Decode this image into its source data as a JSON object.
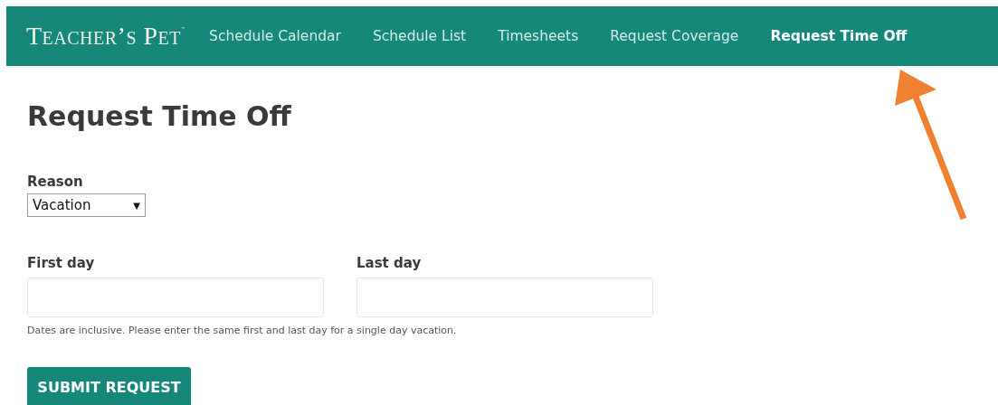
{
  "nav": {
    "logo": "Teacher’s Pet",
    "logo_mark": "™",
    "items": [
      {
        "label": "Schedule Calendar",
        "selected": false
      },
      {
        "label": "Schedule List",
        "selected": false
      },
      {
        "label": "Timesheets",
        "selected": false
      },
      {
        "label": "Request Coverage",
        "selected": false
      },
      {
        "label": "Request Time Off",
        "selected": true
      }
    ]
  },
  "page_title": "Request Time Off",
  "reason": {
    "label": "Reason",
    "value": "Vacation",
    "caret": "▼"
  },
  "first_day": {
    "label": "First day"
  },
  "last_day": {
    "label": "Last day"
  },
  "help_text": "Dates are inclusive. Please enter the same first and last day for a single day vacation.",
  "submit": "SUBMIT REQUEST"
}
